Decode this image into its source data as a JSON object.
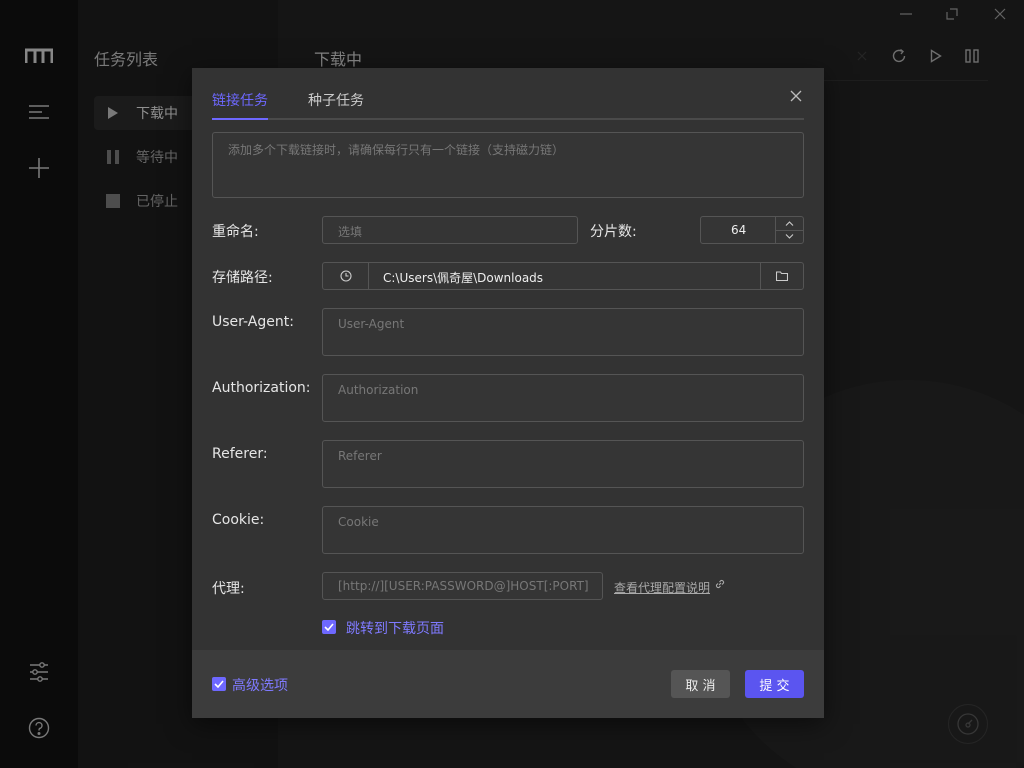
{
  "sidebar": {
    "title": "任务列表",
    "items": [
      {
        "label": "下载中",
        "icon": "play-icon",
        "active": true
      },
      {
        "label": "等待中",
        "icon": "pause-icon",
        "active": false
      },
      {
        "label": "已停止",
        "icon": "stop-icon",
        "active": false
      }
    ]
  },
  "rail_icons": [
    "logo-icon",
    "task-list-icon",
    "add-task-icon",
    "settings-icon",
    "help-icon"
  ],
  "main": {
    "title": "下载中",
    "toolbar_icons": [
      "close-icon",
      "refresh-icon",
      "resume-all-icon",
      "pause-all-icon"
    ]
  },
  "window_controls": [
    "minimize-icon",
    "maximize-icon",
    "close-icon"
  ],
  "dialog": {
    "tabs": [
      {
        "label": "链接任务",
        "active": true
      },
      {
        "label": "种子任务",
        "active": false
      }
    ],
    "urls_placeholder": "添加多个下载链接时，请确保每行只有一个链接（支持磁力链）",
    "rename": {
      "label": "重命名:",
      "placeholder": "选填"
    },
    "split": {
      "label": "分片数:",
      "value": "64"
    },
    "dir": {
      "label": "存储路径:",
      "value": "C:\\Users\\佩奇屋\\Downloads"
    },
    "user_agent": {
      "label": "User-Agent:",
      "placeholder": "User-Agent"
    },
    "authorization": {
      "label": "Authorization:",
      "placeholder": "Authorization"
    },
    "referer": {
      "label": "Referer:",
      "placeholder": "Referer"
    },
    "cookie": {
      "label": "Cookie:",
      "placeholder": "Cookie"
    },
    "proxy": {
      "label": "代理:",
      "placeholder": "[http://][USER:PASSWORD@]HOST[:PORT]",
      "help_link": "查看代理配置说明"
    },
    "jump_checkbox": {
      "label": "跳转到下载页面",
      "checked": true
    },
    "advanced_checkbox": {
      "label": "高级选项",
      "checked": true
    },
    "cancel_label": "取 消",
    "submit_label": "提 交"
  },
  "colors": {
    "accent": "#6e68ff",
    "submit": "#5b55f0",
    "dialog_bg": "#333333",
    "footer_bg": "#3c3c3c"
  }
}
